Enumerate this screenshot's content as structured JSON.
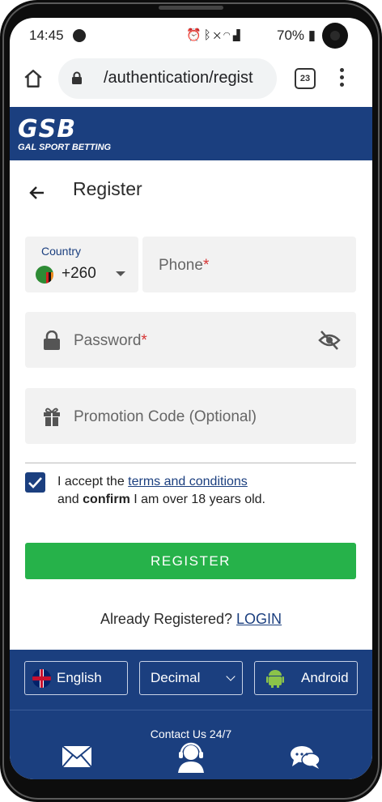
{
  "status_bar": {
    "time": "14:45",
    "battery": "70%",
    "icons": [
      "spotify-icon",
      "alarm-icon",
      "bluetooth-icon",
      "mute-icon",
      "wifi-icon",
      "signal-icon",
      "battery-icon"
    ]
  },
  "browser": {
    "url": "/authentication/regist",
    "tab_count": "23"
  },
  "site": {
    "logo_main": "GSB",
    "logo_sub": "GAL SPORT BETTING",
    "brand_color": "#1b3f7f"
  },
  "page": {
    "title": "Register"
  },
  "form": {
    "country_label": "Country",
    "country_code": "+260",
    "phone_placeholder": "Phone",
    "password_placeholder": "Password",
    "required_mark": "*",
    "promo_placeholder": "Promotion Code (Optional)",
    "terms_prefix": "I accept the ",
    "terms_link": "terms and conditions",
    "terms_and": "and ",
    "terms_confirm": "confirm",
    "terms_suffix": " I am over 18 years old.",
    "accepted": true,
    "register_label": "REGISTER",
    "already_text": "Already Registered?",
    "login_label": "LOGIN",
    "button_color": "#26b24a"
  },
  "footer": {
    "language": "English",
    "odds_format": "Decimal",
    "app": "Android",
    "contact": "Contact Us 24/7",
    "contact_icons": [
      "email-icon",
      "support-agent-icon",
      "chat-icon"
    ]
  }
}
